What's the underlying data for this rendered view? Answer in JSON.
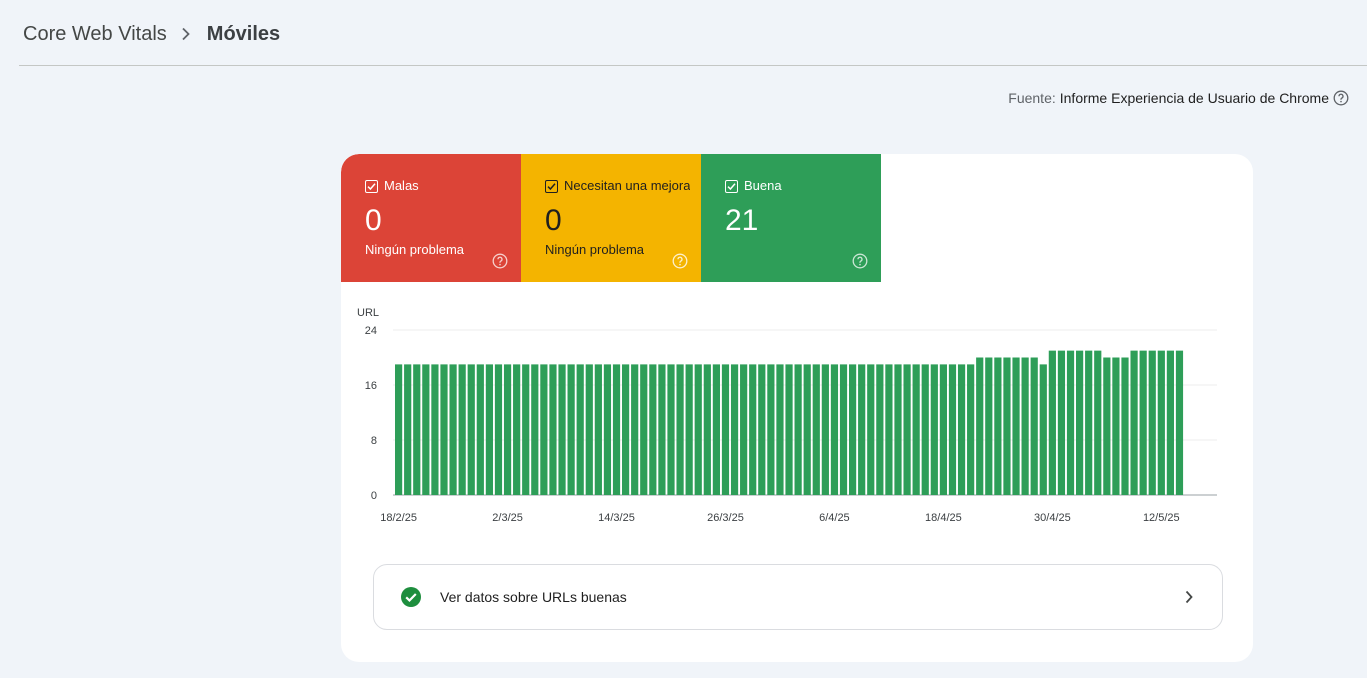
{
  "breadcrumb": {
    "root": "Core Web Vitals",
    "current": "Móviles"
  },
  "source": {
    "label": "Fuente:",
    "name": "Informe Experiencia de Usuario de Chrome"
  },
  "tiles": [
    {
      "id": "poor",
      "label": "Malas",
      "value": "0",
      "sub": "Ningún problema",
      "color": "#dc4437",
      "checked": true
    },
    {
      "id": "ni",
      "label": "Necesitan una mejora",
      "value": "0",
      "sub": "Ningún problema",
      "color": "#f4b400",
      "checked": true
    },
    {
      "id": "good",
      "label": "Buena",
      "value": "21",
      "sub": "",
      "color": "#2e9e58",
      "checked": true
    }
  ],
  "chart_data": {
    "type": "bar",
    "ylabel": "URL",
    "ylim": [
      0,
      24
    ],
    "yticks": [
      0,
      8,
      16,
      24
    ],
    "xtick_labels": [
      "18/2/25",
      "2/3/25",
      "14/3/25",
      "26/3/25",
      "6/4/25",
      "18/4/25",
      "30/4/25",
      "12/5/25"
    ],
    "start_label": "18/2/25",
    "series": [
      {
        "color": "#2e9e58",
        "values": [
          19,
          19,
          19,
          19,
          19,
          19,
          19,
          19,
          19,
          19,
          19,
          19,
          19,
          19,
          19,
          19,
          19,
          19,
          19,
          19,
          19,
          19,
          19,
          19,
          19,
          19,
          19,
          19,
          19,
          19,
          19,
          19,
          19,
          19,
          19,
          19,
          19,
          19,
          19,
          19,
          19,
          19,
          19,
          19,
          19,
          19,
          19,
          19,
          19,
          19,
          19,
          19,
          19,
          19,
          19,
          19,
          19,
          19,
          19,
          19,
          19,
          19,
          19,
          19,
          20,
          20,
          20,
          20,
          20,
          20,
          20,
          19,
          21,
          21,
          21,
          21,
          21,
          21,
          20,
          20,
          20,
          21,
          21,
          21,
          21,
          21,
          21
        ]
      }
    ],
    "grid": true
  },
  "good_link": {
    "label": "Ver datos sobre URLs buenas"
  },
  "colors": {
    "accent_good": "#2e9e58",
    "accent_poor": "#dc4437",
    "accent_ni": "#f4b400"
  }
}
